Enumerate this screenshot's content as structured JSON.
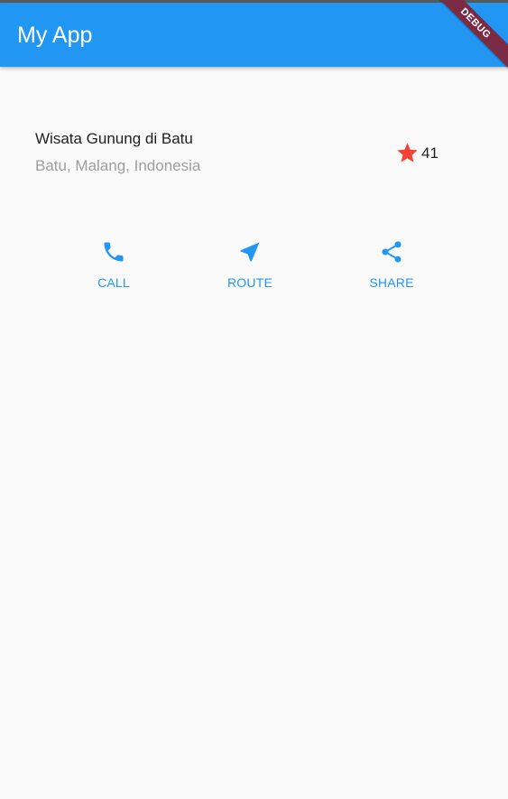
{
  "app_bar": {
    "title": "My App",
    "debug_label": "DEBUG"
  },
  "place": {
    "title": "Wisata Gunung di Batu",
    "subtitle": "Batu, Malang, Indonesia",
    "rating_count": "41"
  },
  "actions": [
    {
      "label": "CALL",
      "icon": "phone-icon"
    },
    {
      "label": "ROUTE",
      "icon": "navigation-icon"
    },
    {
      "label": "SHARE",
      "icon": "share-icon"
    }
  ],
  "colors": {
    "primary": "#2196f3",
    "star": "#f44336",
    "debug_banner": "#7a2b43",
    "background": "#fafafa"
  }
}
